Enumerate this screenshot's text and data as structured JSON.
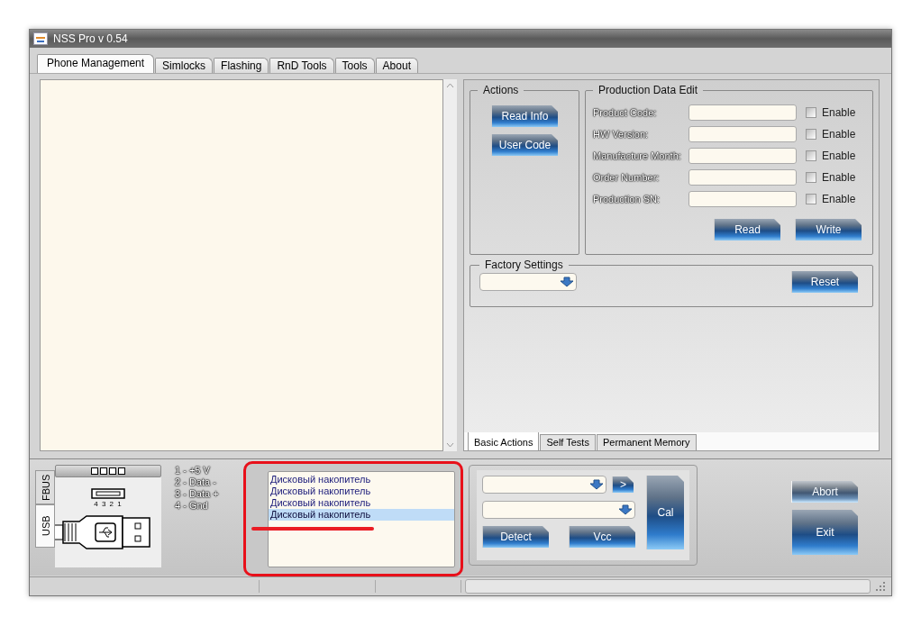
{
  "window": {
    "title": "NSS Pro v 0.54"
  },
  "tabs": [
    {
      "label": "Phone Management",
      "selected": true
    },
    {
      "label": "Simlocks",
      "selected": false
    },
    {
      "label": "Flashing",
      "selected": false
    },
    {
      "label": "RnD Tools",
      "selected": false
    },
    {
      "label": "Tools",
      "selected": false
    },
    {
      "label": "About",
      "selected": false
    }
  ],
  "actions": {
    "title": "Actions",
    "buttons": [
      "Read Info",
      "User Code"
    ]
  },
  "production_data_edit": {
    "title": "Production Data Edit",
    "fields": [
      {
        "label": "Product Code:",
        "enable_label": "Enable",
        "checked": false
      },
      {
        "label": "HW Version:",
        "enable_label": "Enable",
        "checked": false
      },
      {
        "label": "Manufacture Month:",
        "enable_label": "Enable",
        "checked": false
      },
      {
        "label": "Order Number:",
        "enable_label": "Enable",
        "checked": false
      },
      {
        "label": "Production SN:",
        "enable_label": "Enable",
        "checked": false
      }
    ],
    "buttons": [
      "Read",
      "Write"
    ]
  },
  "factory_settings": {
    "title": "Factory Settings",
    "button": "Reset"
  },
  "sub_tabs": [
    {
      "label": "Basic Actions",
      "selected": true
    },
    {
      "label": "Self Tests",
      "selected": false
    },
    {
      "label": "Permanent Memory",
      "selected": false
    }
  ],
  "connection_tabs": [
    {
      "label": "FBUS",
      "selected": false
    },
    {
      "label": "USB",
      "selected": true
    }
  ],
  "usb_pin_numbers": "4 3 2 1",
  "pin_labels": [
    "1 - +5 V",
    "2 - Data -",
    "3 - Data +",
    "4 - Gnd"
  ],
  "devices": [
    {
      "label": "Дисковый накопитель",
      "selected": false
    },
    {
      "label": "Дисковый накопитель",
      "selected": false
    },
    {
      "label": "Дисковый накопитель",
      "selected": false
    },
    {
      "label": "Дисковый накопитель",
      "selected": true
    }
  ],
  "controls": {
    "arrow_button": ">",
    "buttons": [
      "Detect",
      "Vcc"
    ],
    "cal_button": "Cal"
  },
  "abort_button": {
    "label": "Abort",
    "disabled": true
  },
  "exit_button": {
    "label": "Exit",
    "disabled": false
  }
}
